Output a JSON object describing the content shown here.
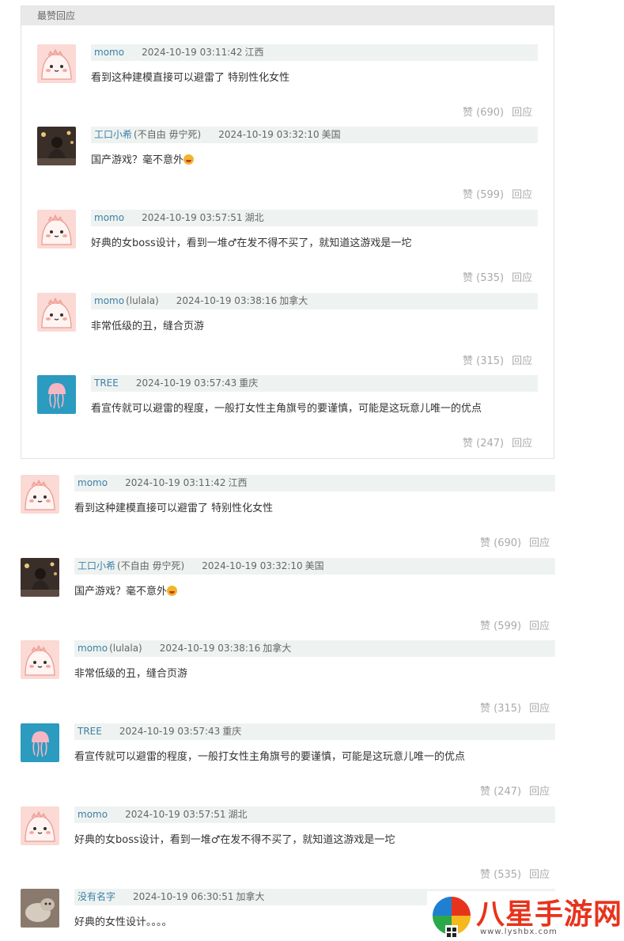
{
  "section_header": "最赞回应",
  "top_comments": [
    {
      "avatar": "pink-dino",
      "user": "momo",
      "tag": "",
      "time": "2024-10-19 03:11:42",
      "location": "江西",
      "text": "看到这种建模直接可以避雷了 特别性化女性",
      "emoji": false,
      "like": "赞 (690)",
      "reply": "回应"
    },
    {
      "avatar": "photo-girl",
      "user": "工口小希",
      "tag": "(不自由 毋宁死)",
      "time": "2024-10-19 03:32:10",
      "location": "美国",
      "text": "国产游戏？毫不意外",
      "emoji": true,
      "like": "赞 (599)",
      "reply": "回应"
    },
    {
      "avatar": "pink-dino",
      "user": "momo",
      "tag": "",
      "time": "2024-10-19 03:57:51",
      "location": "湖北",
      "text": "好典的女boss设计，看到一堆♂在发不得不买了，就知道这游戏是一坨",
      "emoji": false,
      "like": "赞 (535)",
      "reply": "回应"
    },
    {
      "avatar": "pink-dino",
      "user": "momo",
      "tag": "(lulala)",
      "time": "2024-10-19 03:38:16",
      "location": "加拿大",
      "text": "非常低级的丑，缝合页游",
      "emoji": false,
      "like": "赞 (315)",
      "reply": "回应"
    },
    {
      "avatar": "jellyfish",
      "user": "TREE",
      "tag": "",
      "time": "2024-10-19 03:57:43",
      "location": "重庆",
      "text": "看宣传就可以避雷的程度，一般打女性主角旗号的要谨慎，可能是这玩意儿唯一的优点",
      "emoji": false,
      "like": "赞 (247)",
      "reply": "回应"
    }
  ],
  "comments": [
    {
      "avatar": "pink-dino",
      "user": "momo",
      "tag": "",
      "time": "2024-10-19 03:11:42",
      "location": "江西",
      "text": "看到这种建模直接可以避雷了 特别性化女性",
      "emoji": false,
      "like": "赞 (690)",
      "reply": "回应"
    },
    {
      "avatar": "photo-girl",
      "user": "工口小希",
      "tag": "(不自由 毋宁死)",
      "time": "2024-10-19 03:32:10",
      "location": "美国",
      "text": "国产游戏？毫不意外",
      "emoji": true,
      "like": "赞 (599)",
      "reply": "回应"
    },
    {
      "avatar": "pink-dino",
      "user": "momo",
      "tag": "(lulala)",
      "time": "2024-10-19 03:38:16",
      "location": "加拿大",
      "text": "非常低级的丑，缝合页游",
      "emoji": false,
      "like": "赞 (315)",
      "reply": "回应"
    },
    {
      "avatar": "jellyfish",
      "user": "TREE",
      "tag": "",
      "time": "2024-10-19 03:57:43",
      "location": "重庆",
      "text": "看宣传就可以避雷的程度，一般打女性主角旗号的要谨慎，可能是这玩意儿唯一的优点",
      "emoji": false,
      "like": "赞 (247)",
      "reply": "回应"
    },
    {
      "avatar": "pink-dino",
      "user": "momo",
      "tag": "",
      "time": "2024-10-19 03:57:51",
      "location": "湖北",
      "text": "好典的女boss设计，看到一堆♂在发不得不买了，就知道这游戏是一坨",
      "emoji": false,
      "like": "赞 (535)",
      "reply": "回应"
    },
    {
      "avatar": "cat-photo",
      "user": "没有名字",
      "tag": "",
      "time": "2024-10-19 06:30:51",
      "location": "加拿大",
      "text": "好典的女性设计。。。。",
      "emoji": false,
      "like": "",
      "reply": ""
    }
  ],
  "watermark": {
    "name": "八星手游网",
    "url": "www.lyshbx.com"
  },
  "colors": {
    "username": "#3d7fa6",
    "meta_bg": "#eef3f1",
    "header_bg": "#e9e9e9",
    "action": "#aaaaaa",
    "watermark": "#e8331c"
  }
}
